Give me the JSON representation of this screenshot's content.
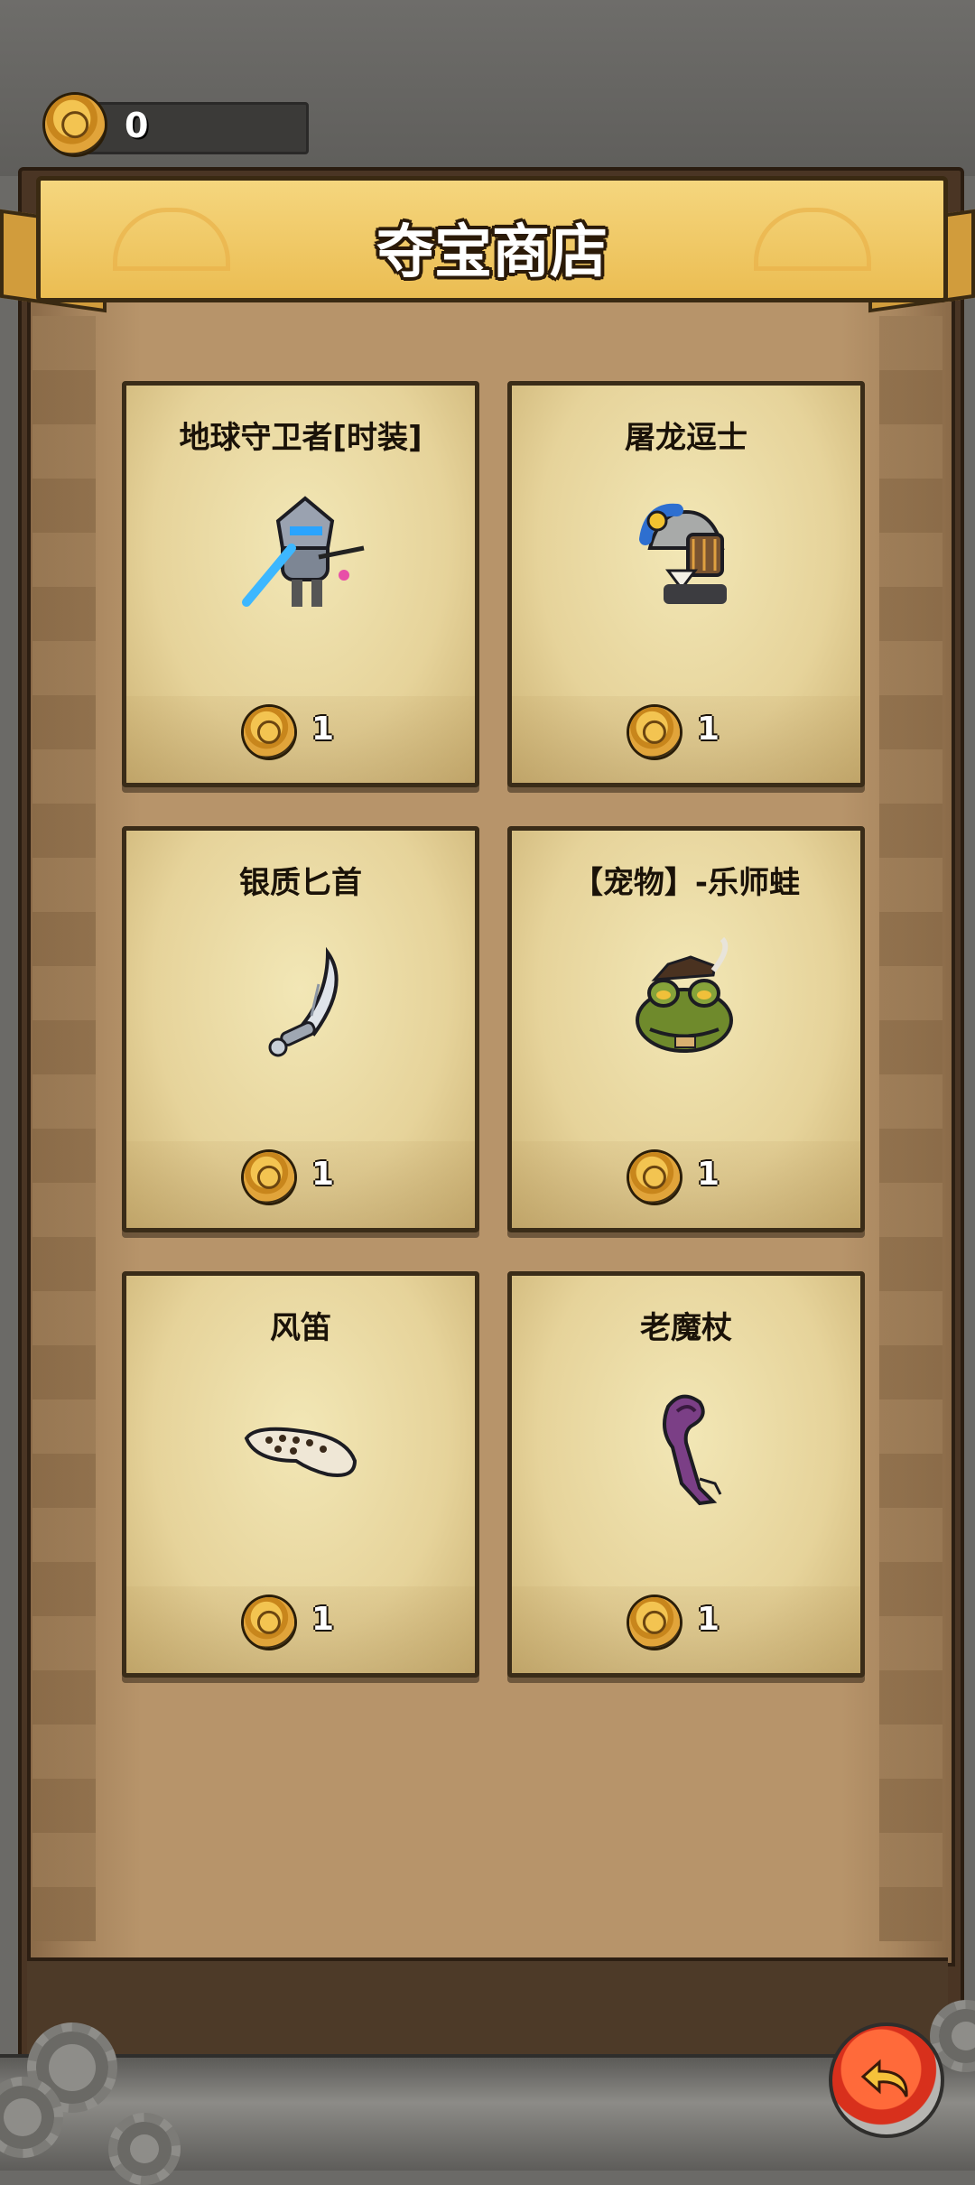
{
  "header": {
    "currency_amount": "0",
    "currency_icon": "gold-coin-icon"
  },
  "shop": {
    "title": "夺宝商店"
  },
  "items": [
    {
      "name": "地球守卫者[时装]",
      "price": "1",
      "icon": "earth-guardian-costume-icon"
    },
    {
      "name": "屠龙逗士",
      "price": "1",
      "icon": "dragon-slayer-knight-icon"
    },
    {
      "name": "银质匕首",
      "price": "1",
      "icon": "silver-dagger-icon"
    },
    {
      "name": "【宠物】-乐师蛙",
      "price": "1",
      "icon": "musician-frog-pet-icon"
    },
    {
      "name": "风笛",
      "price": "1",
      "icon": "ocarina-flute-icon"
    },
    {
      "name": "老魔杖",
      "price": "1",
      "icon": "old-magic-staff-icon"
    }
  ],
  "footer": {
    "back_icon": "back-arrow-icon"
  },
  "colors": {
    "banner": "#ebbd52",
    "card": "#e6d39a",
    "board": "#b7946a",
    "back_button": "#d8301c"
  }
}
